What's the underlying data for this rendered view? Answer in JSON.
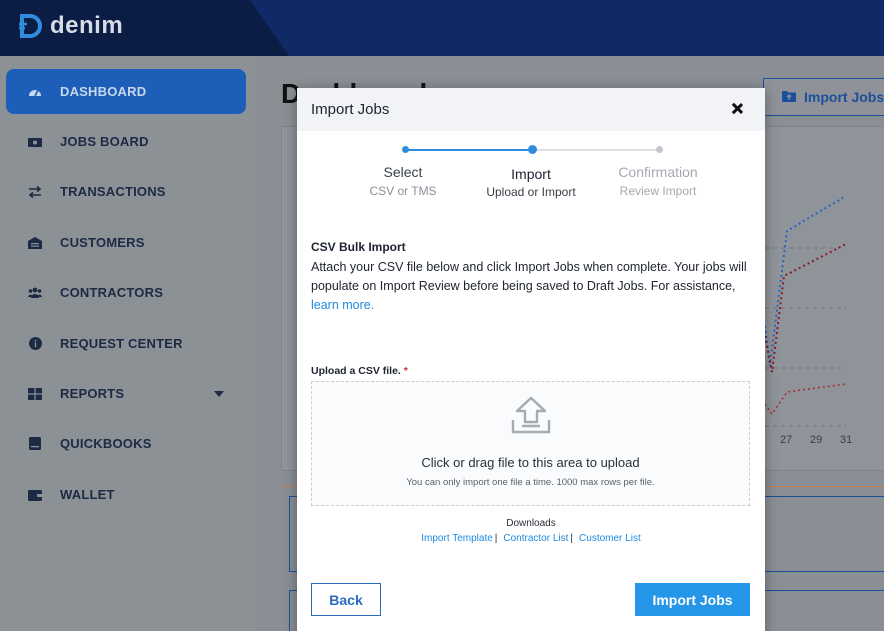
{
  "app": {
    "brand": "denim"
  },
  "sidebar": {
    "items": [
      {
        "label": "DASHBOARD",
        "icon": "speedometer-icon",
        "active": true
      },
      {
        "label": "JOBS BOARD",
        "icon": "money-icon"
      },
      {
        "label": "TRANSACTIONS",
        "icon": "exchange-icon"
      },
      {
        "label": "CUSTOMERS",
        "icon": "warehouse-icon"
      },
      {
        "label": "CONTRACTORS",
        "icon": "users-icon"
      },
      {
        "label": "REQUEST CENTER",
        "icon": "info-icon"
      },
      {
        "label": "REPORTS",
        "icon": "grid-icon",
        "has_dropdown": true
      },
      {
        "label": "QUICKBOOKS",
        "icon": "book-icon"
      },
      {
        "label": "WALLET",
        "icon": "wallet-icon"
      }
    ]
  },
  "background": {
    "page_title": "Dashboard",
    "import_button_label": "Import Jobs",
    "x_ticks": [
      "27",
      "29",
      "31"
    ]
  },
  "modal": {
    "title": "Import Jobs",
    "steps": [
      {
        "label": "Select",
        "sub": "CSV or TMS",
        "state": "done"
      },
      {
        "label": "Import",
        "sub": "Upload or Import",
        "state": "current"
      },
      {
        "label": "Confirmation",
        "sub": "Review Import",
        "state": "pending"
      }
    ],
    "section_title": "CSV Bulk Import",
    "section_desc": "Attach your CSV file below and click Import Jobs when complete. Your jobs will populate on Import Review before being saved to Draft Jobs. For assistance, ",
    "learn_more": "learn more.",
    "upload_label": "Upload a CSV file.",
    "required_mark": "*",
    "dropzone_main": "Click or drag file to this area to upload",
    "dropzone_sub": "You can only import one file a time. 1000 max rows per file.",
    "downloads_title": "Downloads",
    "downloads": [
      "Import Template",
      "Contractor List",
      "Customer List"
    ],
    "link_separator": "|",
    "back_label": "Back",
    "import_label": "Import Jobs"
  },
  "colors": {
    "accent": "#2596e8",
    "step_done": "#2f8de0",
    "step_pending": "#c4c8ce",
    "active_nav": "#1d5fb8",
    "topbar": "#0b1d44"
  }
}
